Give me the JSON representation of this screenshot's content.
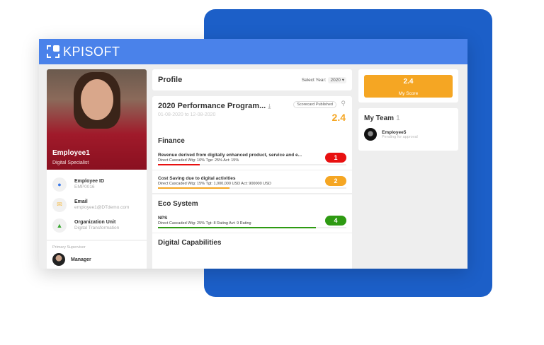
{
  "brand": {
    "name": "KPISOFT"
  },
  "employee": {
    "name": "Employee1",
    "role": "Digital Specialist",
    "fields": [
      {
        "label": "Employee ID",
        "value": "EMP0016",
        "icon": "person-icon"
      },
      {
        "label": "Email",
        "value": "employee1@DTdemo.com",
        "icon": "mail-icon"
      },
      {
        "label": "Organization Unit",
        "value": "Digital Transformation",
        "icon": "org-chart-icon"
      }
    ],
    "supervisor_label": "Primary Supervisor",
    "supervisor": "Manager"
  },
  "profile": {
    "title": "Profile",
    "select_year_label": "Select Year:",
    "year": "2020"
  },
  "program": {
    "title": "2020 Performance Program...",
    "dates": "01-08-2020 to 12-08-2020",
    "status": "Scorecard Published",
    "score": "2.4",
    "sections": [
      {
        "name": "Finance",
        "kpis": [
          {
            "title": "Revenue derived from digitally enhanced product, service and e...",
            "sub": "Direct Cascaded Wtg: 10% Tge: 25% Act: 15%",
            "rating": "1",
            "progress": 0.22,
            "color": "#e81010"
          },
          {
            "title": "Cost Saving due to digital activities",
            "sub": "Direct Cascaded Wtg: 15% Tgt: 1,000,000 USD Act: 900000 USD",
            "rating": "2",
            "progress": 0.38,
            "color": "#f5a623"
          }
        ]
      },
      {
        "name": "Eco System",
        "kpis": [
          {
            "title": "NPS",
            "sub": "Direct Cascaded Wtg: 25% Tgt: 8 Rating Avt: 9 Rating",
            "rating": "4",
            "progress": 0.84,
            "color": "#2e9a12"
          }
        ]
      },
      {
        "name": "Digital Capabilities",
        "kpis": []
      }
    ]
  },
  "my_score": {
    "value": "2.4",
    "label": "My Score"
  },
  "team": {
    "title": "My Team",
    "count": "1",
    "members": [
      {
        "name": "Employee5",
        "status": "Pending for approval"
      }
    ]
  }
}
